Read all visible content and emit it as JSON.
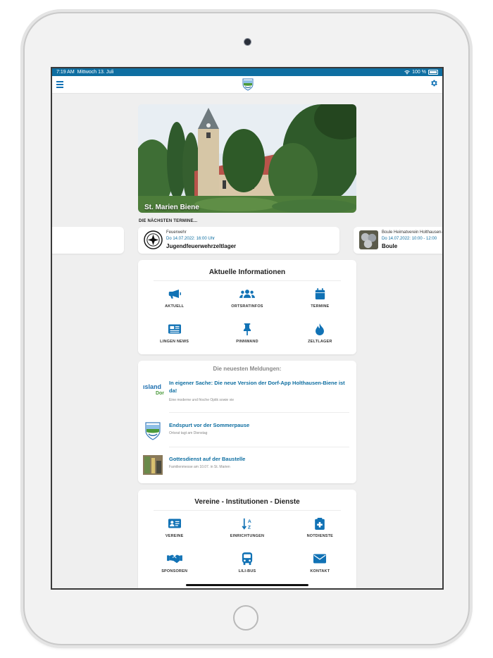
{
  "status_bar": {
    "time": "7:19 AM",
    "date": "Mittwoch 13. Juli",
    "battery": "100 %"
  },
  "hero": {
    "caption": "St. Marien Biene"
  },
  "upcoming": {
    "label": "DIE NÄCHSTEN TERMINE...",
    "events": [
      {
        "category": "Feuerwehr",
        "date": "Do 14.07.2022: 16:00 Uhr",
        "title": "Jugendfeuerwehrzeltlager",
        "emblem": "fire-brigade-emblem"
      },
      {
        "category": "Boule Heimatverein Holthausen-",
        "date": "Do 14.07.2022: 10:00 - 12:00",
        "title": "Boule",
        "emblem": "boule-balls-photo"
      }
    ]
  },
  "info_section": {
    "title": "Aktuelle Informationen",
    "tiles": [
      {
        "label": "AKTUELL",
        "icon": "megaphone-icon"
      },
      {
        "label": "ORTSRATINFOS",
        "icon": "people-icon"
      },
      {
        "label": "TERMINE",
        "icon": "calendar-icon"
      },
      {
        "label": "LINGEN NEWS",
        "icon": "newspaper-icon"
      },
      {
        "label": "PINNWAND",
        "icon": "pushpin-icon"
      },
      {
        "label": "ZELTLAGER",
        "icon": "flame-icon"
      }
    ]
  },
  "news": {
    "heading": "Die neuesten Meldungen:",
    "items": [
      {
        "title": "In eigener Sache: Die neue Version der Dorf-App Holthausen-Biene ist da!",
        "subtitle": "Eine moderne und frische Optik sowie vie",
        "thumb_text": "ısland",
        "thumb_text2": "Dor"
      },
      {
        "title": "Endspurt vor der Sommerpause",
        "subtitle": "Ortsrat tagt am Dienstag"
      },
      {
        "title": "Gottesdienst auf der Baustelle",
        "subtitle": "Familienmesse am 10.07. in St. Marien"
      }
    ]
  },
  "vereine_section": {
    "title": "Vereine - Institutionen - Dienste",
    "tiles": [
      {
        "label": "VEREINE",
        "icon": "id-card-icon"
      },
      {
        "label": "EINRICHTUNGEN",
        "icon": "sort-alpha-icon"
      },
      {
        "label": "NOTDIENSTE",
        "icon": "medical-clipboard-icon"
      },
      {
        "label": "SPONSOREN",
        "icon": "handshake-icon"
      },
      {
        "label": "LILI-BUS",
        "icon": "bus-icon"
      },
      {
        "label": "KONTAKT",
        "icon": "envelope-icon"
      }
    ]
  },
  "colors": {
    "accent": "#1172b5",
    "status_bar": "#0e6ea1",
    "link": "#0e6ea1"
  }
}
